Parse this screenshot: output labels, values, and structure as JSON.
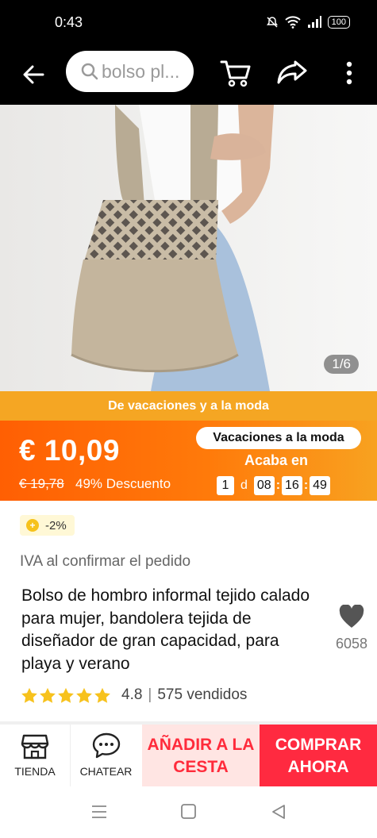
{
  "status_bar": {
    "time": "0:43",
    "battery": "100"
  },
  "top_bar": {
    "search_placeholder": "bolso pl..."
  },
  "product_image": {
    "counter": "1/6"
  },
  "promo": {
    "banner": "De vacaciones y a la moda",
    "price": "€ 10,09",
    "original_price": "€ 19,78",
    "discount": "49% Descuento",
    "event_badge": "Vacaciones a la moda",
    "ends_label": "Acaba en",
    "countdown": {
      "days": "1",
      "day_unit": "d",
      "hours": "08",
      "minutes": "16",
      "seconds": "49"
    }
  },
  "info": {
    "coupon": "-2%",
    "tax_note": "IVA al confirmar el pedido",
    "title": "Bolso de hombro informal tejido calado para mujer, bandolera tejida de diseñador de gran capacidad, para playa y verano",
    "wishlist_count": "6058",
    "rating": "4.8",
    "rating_separator": "|",
    "stars": 5,
    "sold": "575 vendidos"
  },
  "bottom_bar": {
    "store_label": "TIENDA",
    "chat_label": "CHATEAR",
    "add_to_cart_line1": "AÑADIR A LA",
    "add_to_cart_line2": "CESTA",
    "buy_now_line1": "COMPRAR",
    "buy_now_line2": "AHORA"
  },
  "colors": {
    "promo_orange": "#ff6a07",
    "banner_yellow": "#f5a623",
    "cart_red": "#ff2b3b",
    "cart_bg": "#ffe5e3",
    "buy_red": "#ff2a40",
    "star": "#f7c21d"
  },
  "icons": [
    "back-arrow-icon",
    "search-icon",
    "cart-icon",
    "share-icon",
    "more-vertical-icon",
    "coin-icon",
    "star-icon",
    "heart-icon",
    "store-icon",
    "chat-icon",
    "menu-icon",
    "home-icon",
    "back-triangle-icon",
    "wifi-icon",
    "signal-icon",
    "mute-icon"
  ]
}
